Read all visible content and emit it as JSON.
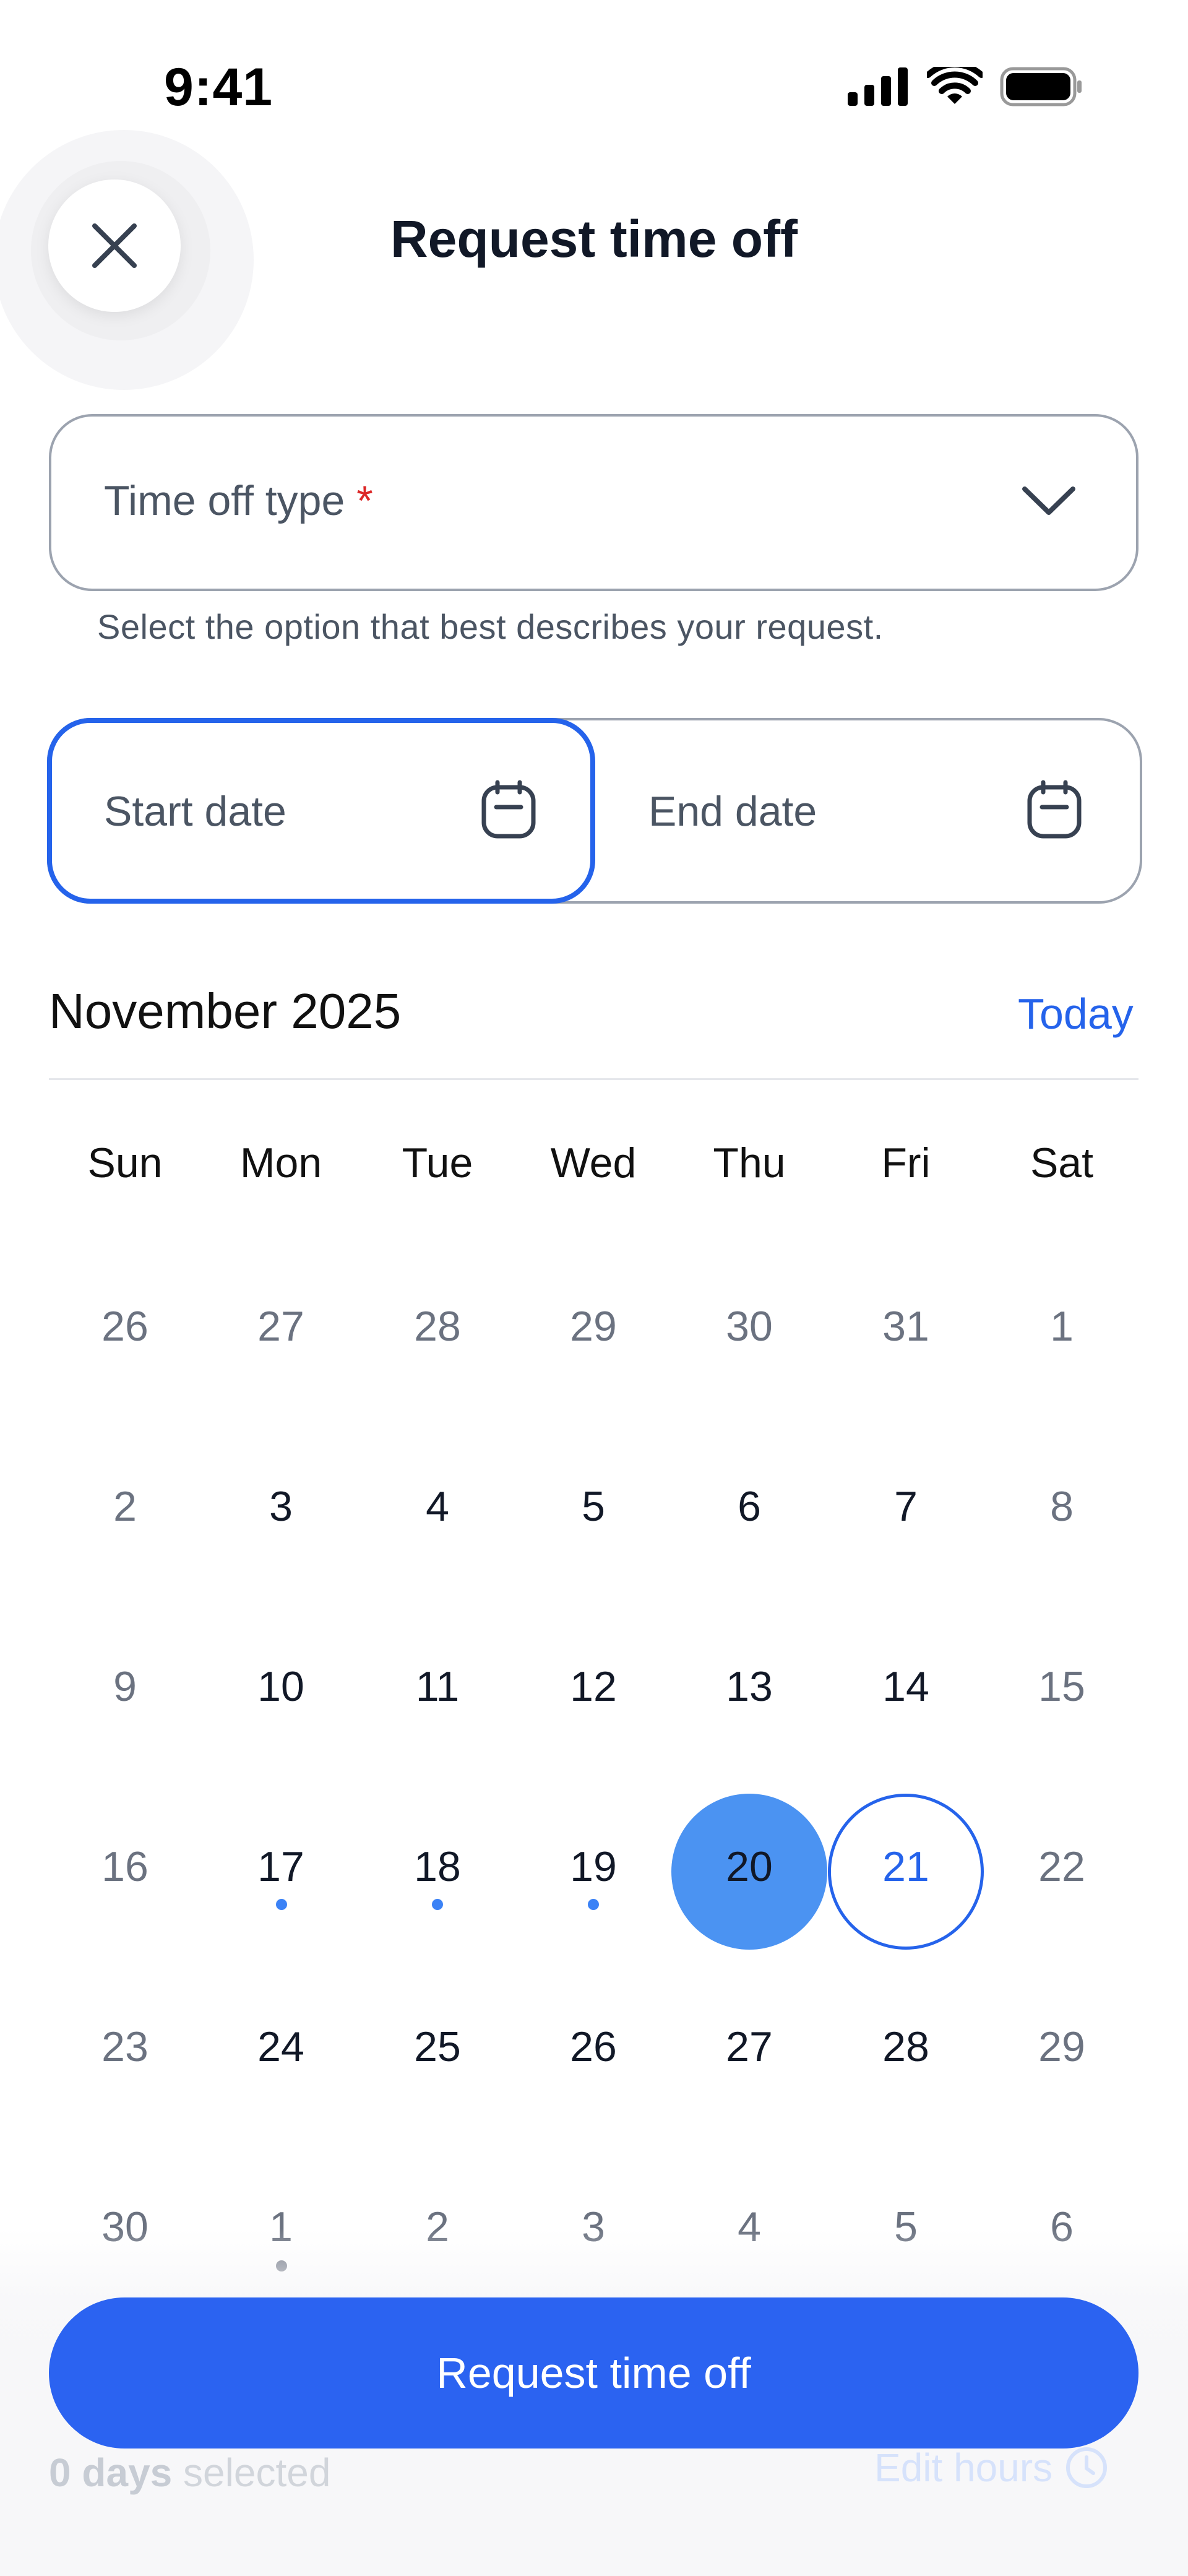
{
  "status_bar": {
    "time": "9:41",
    "icons": [
      "signal-icon",
      "wifi-icon",
      "battery-icon"
    ]
  },
  "header": {
    "title": "Request time off",
    "close_icon": "close-icon"
  },
  "time_off_type": {
    "label": "Time off type",
    "required_mark": "*",
    "helper": "Select the option that best describes your request.",
    "icon": "chevron-down-icon"
  },
  "dates": {
    "start_placeholder": "Start date",
    "end_placeholder": "End date",
    "icon": "calendar-icon"
  },
  "calendar": {
    "month": "November 2025",
    "today_label": "Today",
    "weekdays": [
      "Sun",
      "Mon",
      "Tue",
      "Wed",
      "Thu",
      "Fri",
      "Sat"
    ],
    "weeks": [
      [
        "26",
        "27",
        "28",
        "29",
        "30",
        "31",
        "1"
      ],
      [
        "2",
        "3",
        "4",
        "5",
        "6",
        "7",
        "8"
      ],
      [
        "9",
        "10",
        "11",
        "12",
        "13",
        "14",
        "15"
      ],
      [
        "16",
        "17",
        "18",
        "19",
        "20",
        "21",
        "22"
      ],
      [
        "23",
        "24",
        "25",
        "26",
        "27",
        "28",
        "29"
      ],
      [
        "30",
        "1",
        "2",
        "3",
        "4",
        "5",
        "6"
      ]
    ],
    "selected_day": "20",
    "today_day": "21"
  },
  "footer": {
    "primary_button": "Request time off",
    "days_count": "0 days",
    "days_suffix": " selected",
    "edit_hours": "Edit hours",
    "edit_icon": "clock-icon"
  },
  "colors": {
    "accent": "#2563eb",
    "selected_fill": "#4b93f2",
    "button": "#2b63f1",
    "required": "#dc2626"
  }
}
